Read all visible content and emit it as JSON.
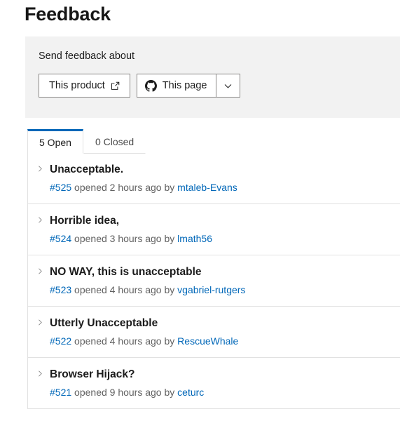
{
  "page_title": "Feedback",
  "feedback_panel": {
    "label": "Send feedback about",
    "buttons": {
      "this_product": {
        "label": "This product",
        "icon": "external-link-icon"
      },
      "this_page": {
        "label": "This page",
        "icon": "github-icon"
      },
      "dropdown": {
        "icon": "chevron-down-icon"
      }
    }
  },
  "tabs": [
    {
      "label": "5 Open",
      "active": true
    },
    {
      "label": "0 Closed",
      "active": false
    }
  ],
  "issues": [
    {
      "title": "Unacceptable.",
      "number": "#525",
      "meta_text": " opened 2 hours ago by ",
      "author": "mtaleb-Evans",
      "chevron": "chevron-right-icon"
    },
    {
      "title": "Horrible idea,",
      "number": "#524",
      "meta_text": " opened 3 hours ago by ",
      "author": "lmath56",
      "chevron": "chevron-right-icon"
    },
    {
      "title": "NO WAY, this is unacceptable",
      "number": "#523",
      "meta_text": " opened 4 hours ago by ",
      "author": "vgabriel-rutgers",
      "chevron": "chevron-right-icon"
    },
    {
      "title": "Utterly Unacceptable",
      "number": "#522",
      "meta_text": " opened 4 hours ago by ",
      "author": "RescueWhale",
      "chevron": "chevron-right-icon"
    },
    {
      "title": "Browser Hijack?",
      "number": "#521",
      "meta_text": " opened 9 hours ago by ",
      "author": "ceturc",
      "chevron": "chevron-right-icon"
    }
  ],
  "colors": {
    "accent": "#0067b8",
    "panel_bg": "#f2f2f2",
    "border": "#e1e1e1",
    "button_border": "#8a8886",
    "text": "#1b1b1b",
    "muted_text": "#616161"
  }
}
